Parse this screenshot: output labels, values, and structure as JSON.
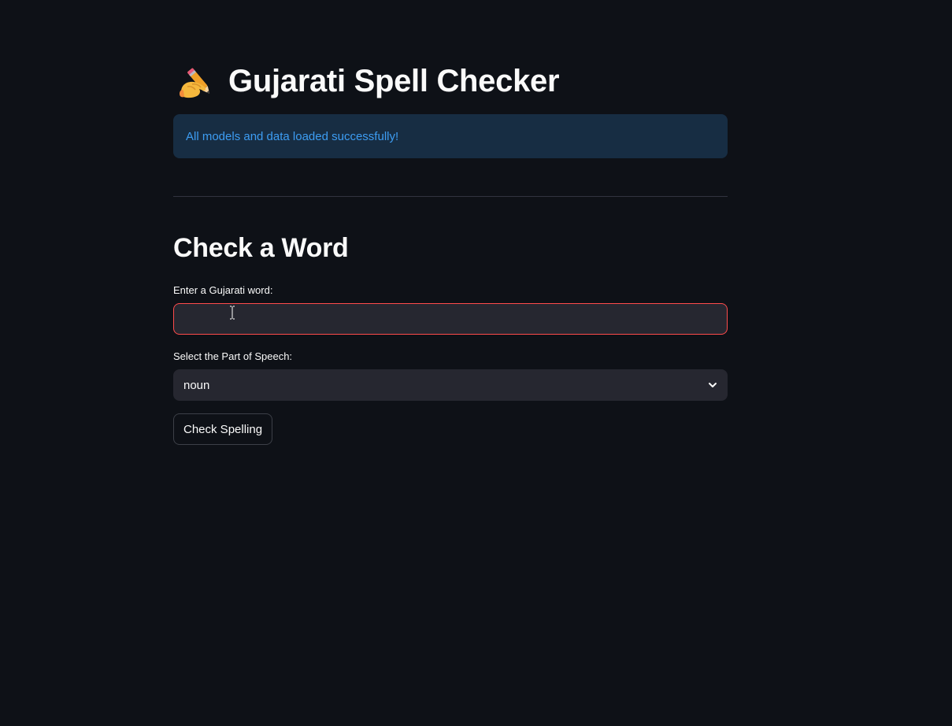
{
  "header": {
    "title_icon": "writing-hand-icon",
    "title": "Gujarati Spell Checker"
  },
  "alert": {
    "message": "All models and data loaded successfully!",
    "type": "info",
    "text_color": "#3d9df3",
    "background_color": "#172d43"
  },
  "section": {
    "title": "Check a Word"
  },
  "word_input": {
    "label": "Enter a Gujarati word:",
    "value": "",
    "placeholder": "",
    "border_color": "#ff4b4b"
  },
  "pos_select": {
    "label": "Select the Part of Speech:",
    "selected": "noun",
    "icon": "chevron-down-icon"
  },
  "actions": {
    "check_label": "Check Spelling"
  },
  "theme": {
    "background": "#0e1117",
    "widget_background": "#262730",
    "text": "#fafafa"
  }
}
